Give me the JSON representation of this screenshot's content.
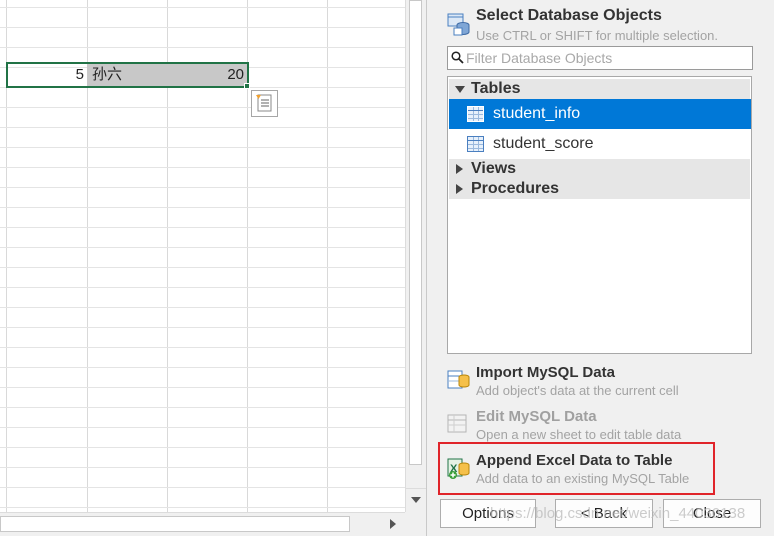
{
  "sheet": {
    "row": {
      "col_a": "5",
      "col_b": "孙六",
      "col_c": "20"
    }
  },
  "panel": {
    "header": {
      "title": "Select Database Objects",
      "subtitle": "Use CTRL or SHIFT for multiple selection."
    },
    "filter": {
      "placeholder": "Filter Database Objects"
    },
    "tree": {
      "tables_label": "Tables",
      "tables": [
        {
          "label": "student_info",
          "selected": true
        },
        {
          "label": "student_score",
          "selected": false
        }
      ],
      "views_label": "Views",
      "procedures_label": "Procedures"
    },
    "actions": [
      {
        "title": "Import MySQL Data",
        "subtitle": "Add object's data at the current cell",
        "enabled": true
      },
      {
        "title": "Edit MySQL Data",
        "subtitle": "Open a new sheet to edit table data",
        "enabled": false
      },
      {
        "title": "Append Excel Data to Table",
        "subtitle": "Add data to an existing MySQL Table",
        "enabled": true,
        "highlighted": true
      }
    ],
    "buttons": {
      "options": "Options",
      "back": "< Back",
      "close": "Close"
    }
  },
  "watermark": "https://blog.csdn.net/weixin_44030138",
  "colors": {
    "selection_blue": "#0078d7",
    "excel_green": "#217346",
    "highlight_red": "#e0242a"
  }
}
